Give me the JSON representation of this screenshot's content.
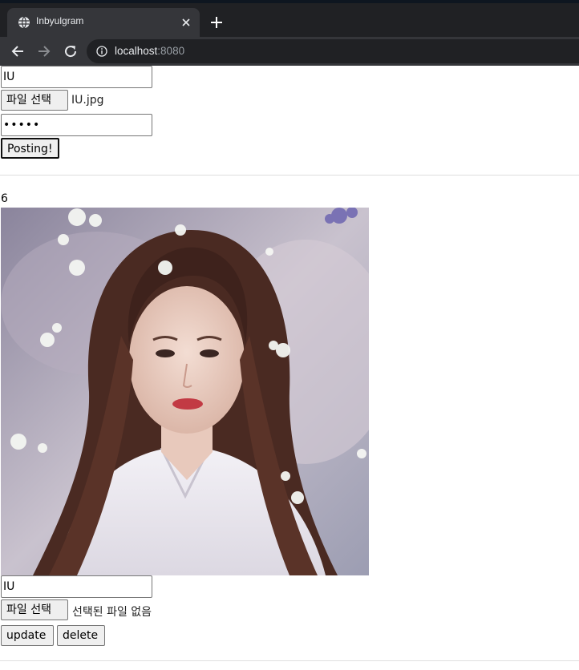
{
  "browser": {
    "tab_title": "Inbyulgram",
    "url_host": "localhost",
    "url_port": ":8080",
    "icons": {
      "favicon": "globe-icon",
      "tab_close": "close-icon",
      "new_tab": "plus-icon",
      "back": "back-arrow-icon",
      "forward": "forward-arrow-icon",
      "reload": "reload-icon",
      "site_info": "info-icon"
    },
    "colors": {
      "tabbar": "#202124",
      "toolbar": "#35363a",
      "omnibox": "#202124"
    }
  },
  "create_form": {
    "author_value": "IU",
    "file_button_label": "파일 선택",
    "file_name": "IU.jpg",
    "password_value": "•••••",
    "submit_label": "Posting!"
  },
  "post": {
    "id": "6",
    "author_value": "IU",
    "file_button_label": "파일 선택",
    "file_status": "선택된 파일 없음",
    "update_label": "update",
    "delete_label": "delete"
  }
}
